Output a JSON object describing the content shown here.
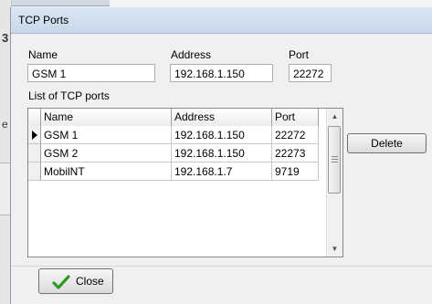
{
  "background": {
    "fragment_top": "3",
    "fragment_mid": "e"
  },
  "dialog": {
    "title": "TCP Ports",
    "name_label": "Name",
    "address_label": "Address",
    "port_label": "Port",
    "name_value": "GSM 1",
    "address_value": "192.168.1.150",
    "port_value": "22272",
    "list_label": "List of TCP ports",
    "columns": [
      "Name",
      "Address",
      "Port"
    ],
    "rows": [
      {
        "name": "GSM 1",
        "address": "192.168.1.150",
        "port": "22272",
        "selected": true
      },
      {
        "name": "GSM 2",
        "address": "192.168.1.150",
        "port": "22273",
        "selected": false
      },
      {
        "name": "MobilNT",
        "address": "192.168.1.7",
        "port": "9719",
        "selected": false
      }
    ],
    "delete_label": "Delete",
    "close_label": "Close",
    "icons": {
      "current_row": "row-indicator-icon",
      "close": "checkmark-icon"
    },
    "colors": {
      "checkmark": "#2e9a1f",
      "title_bar": "#c9d7ea"
    }
  }
}
